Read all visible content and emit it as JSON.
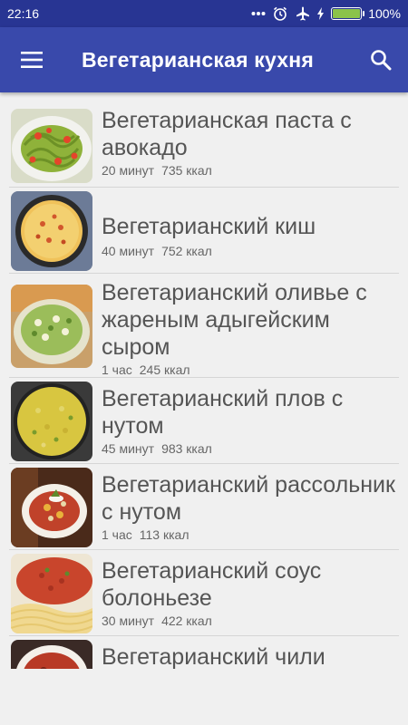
{
  "status_bar": {
    "time": "22:16",
    "battery_text": "100%",
    "battery_level": 1.0
  },
  "app_bar": {
    "title": "Вегетарианская кухня",
    "menu_icon": "hamburger-menu-icon",
    "search_icon": "search-icon"
  },
  "recipes": [
    {
      "title": "Вегетарианская паста с авокадо",
      "time": "20 минут",
      "calories": "735 ккал"
    },
    {
      "title": "Вегетарианский киш",
      "time": "40 минут",
      "calories": "752 ккал"
    },
    {
      "title": "Вегетарианский оливье с жареным адыгейским сыром",
      "time": "1 час",
      "calories": "245 ккал"
    },
    {
      "title": "Вегетарианский плов с нутом",
      "time": "45 минут",
      "calories": "983 ккал"
    },
    {
      "title": "Вегетарианский рассольник с нутом",
      "time": "1 час",
      "calories": "113 ккал"
    },
    {
      "title": "Вегетарианский соус болоньезе",
      "time": "30 минут",
      "calories": "422 ккал"
    },
    {
      "title": "Вегетарианский чили"
    }
  ],
  "colors": {
    "status_bar": "#283593",
    "app_bar": "#3949ab",
    "background": "#f0f0f0"
  }
}
